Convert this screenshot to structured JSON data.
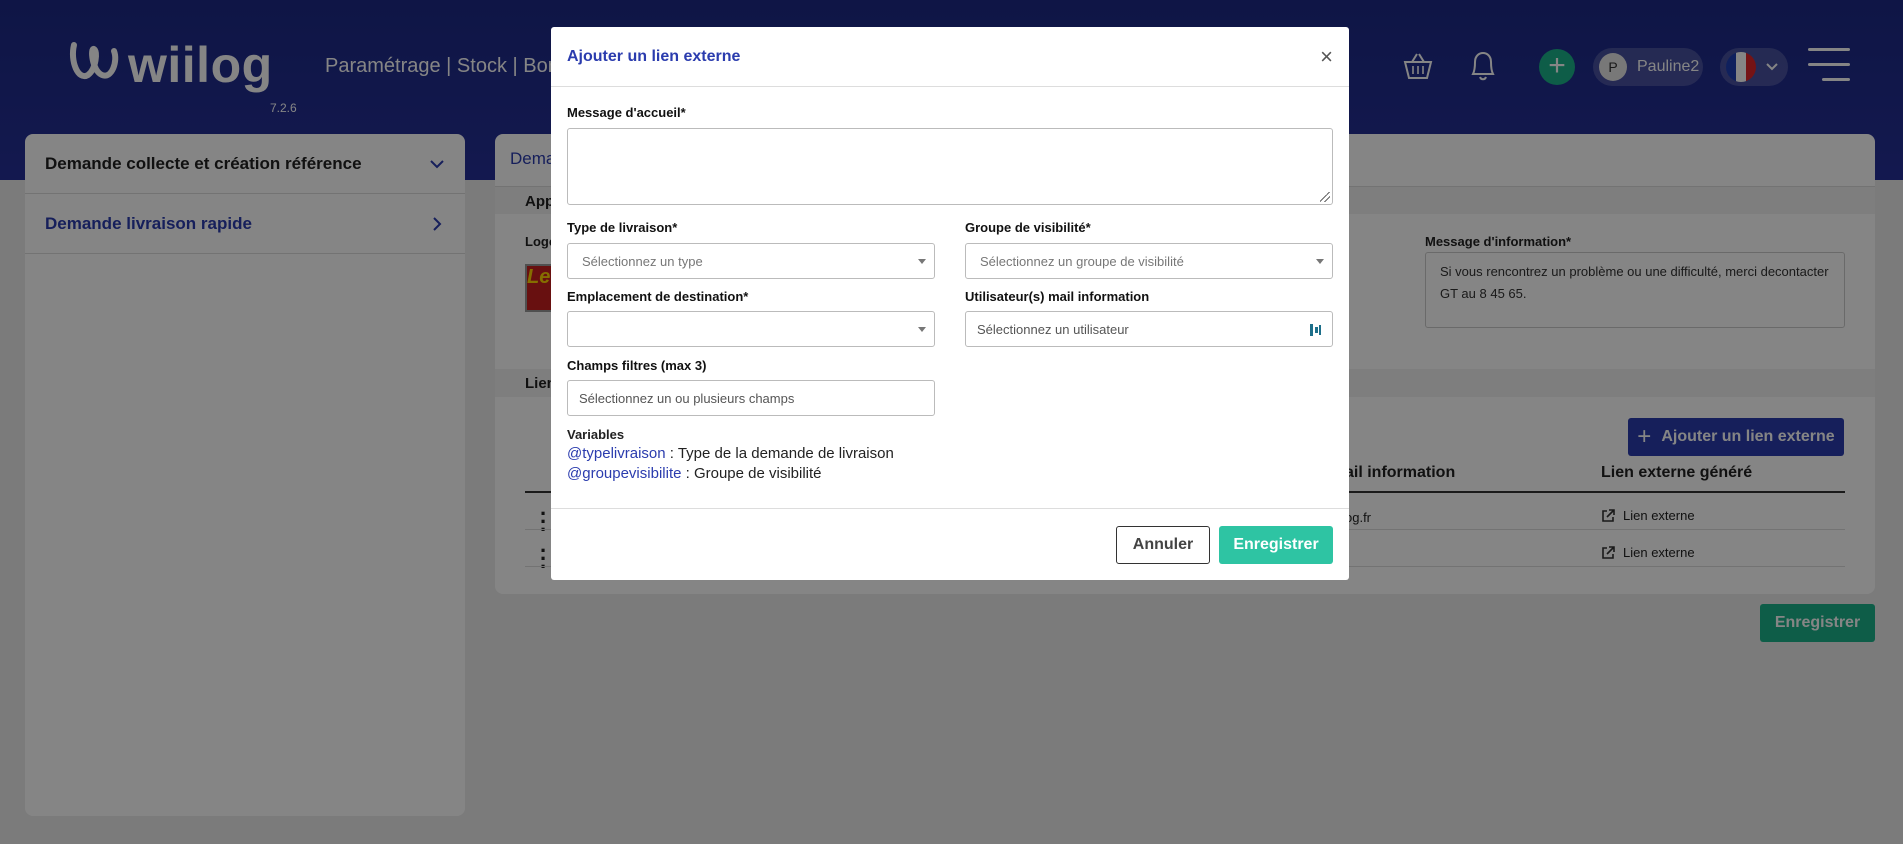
{
  "header": {
    "logo_text": "wiilog",
    "version": "7.2.6",
    "breadcrumb": "Paramétrage | Stock | Borne",
    "user_initial": "P",
    "user_name": "Pauline2"
  },
  "sidebar": {
    "items": [
      {
        "label": "Demande collecte et création référence"
      },
      {
        "label": "Demande livraison rapide"
      }
    ]
  },
  "main": {
    "tab_label": "Dema",
    "section1_label": "App",
    "logo_label": "Logo",
    "logo_thumb_text": "Le",
    "info_message_label": "Message d'information*",
    "info_message_value": "Si vous rencontrez un problème ou une difficulté, merci decontacter GT au 8 45 65.",
    "section2_label": "Lien",
    "add_link_button": "Ajouter un lien externe",
    "columns": [
      "ail information",
      "Lien externe généré"
    ],
    "rows": [
      {
        "mail": "og.fr",
        "link": "Lien externe"
      },
      {
        "mail": "",
        "link": "Lien externe"
      }
    ],
    "save_button": "Enregistrer"
  },
  "modal": {
    "title": "Ajouter un lien externe",
    "welcome_label": "Message d'accueil*",
    "welcome_value": "",
    "delivery_type_label": "Type de livraison*",
    "delivery_type_placeholder": "Sélectionnez un type",
    "visibility_group_label": "Groupe de visibilité*",
    "visibility_group_placeholder": "Sélectionnez un groupe de visibilité",
    "destination_label": "Emplacement de destination*",
    "destination_value": "",
    "users_mail_label": "Utilisateur(s) mail information",
    "users_mail_placeholder": "Sélectionnez un utilisateur",
    "filter_fields_label": "Champs filtres (max 3)",
    "filter_fields_placeholder": "Sélectionnez un ou plusieurs champs",
    "variables_title": "Variables",
    "variables": [
      {
        "name": "@typelivraison",
        "desc": " : Type de la demande de livraison"
      },
      {
        "name": "@groupevisibilite",
        "desc": " : Groupe de visibilité"
      }
    ],
    "cancel_button": "Annuler",
    "save_button": "Enregistrer"
  },
  "colors": {
    "header_blue": "#1d2a86",
    "accent_blue": "#2b3cae",
    "green": "#1bb38a",
    "modal_save": "#2ec4a3"
  },
  "icons": [
    "basket-icon",
    "bell-icon",
    "plus-icon",
    "chevron-down-icon",
    "chevron-right-icon",
    "menu-icon",
    "close-icon",
    "external-link-icon",
    "user-icon"
  ]
}
